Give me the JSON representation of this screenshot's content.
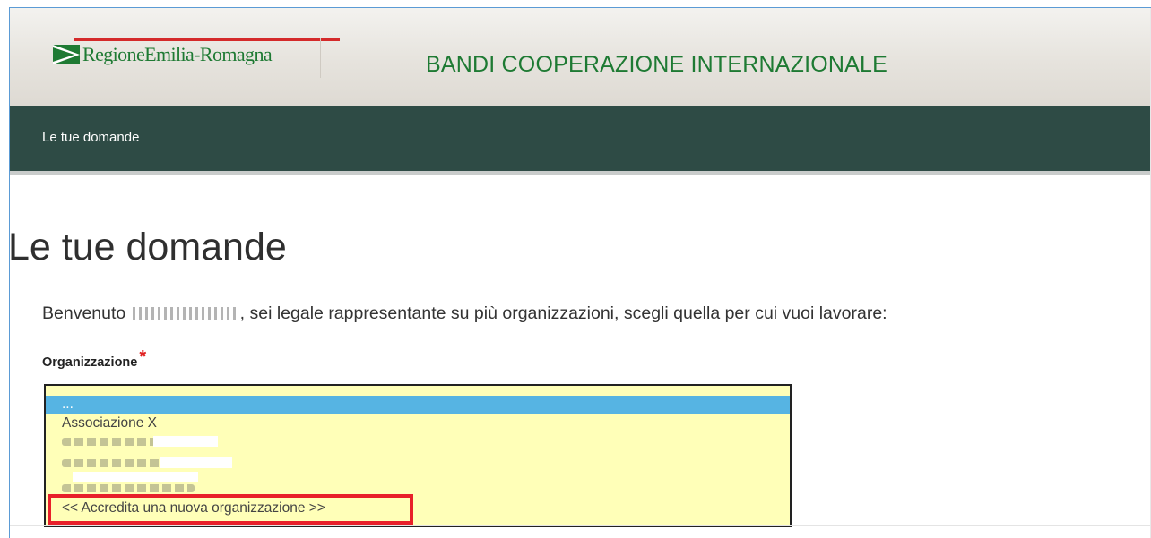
{
  "header": {
    "logo_text": "RegioneEmilia-Romagna",
    "site_title": "BANDI COOPERAZIONE INTERNAZIONALE"
  },
  "nav": {
    "link_label": "Le tue domande"
  },
  "main": {
    "page_title": "Le tue domande",
    "welcome_prefix": "Benvenuto",
    "welcome_suffix": ", sei legale rappresentante su più organizzazioni, scegli quella per cui vuoi lavorare:",
    "field_label": "Organizzazione",
    "required_mark": "*"
  },
  "listbox": {
    "options": [
      "...",
      "Associazione X",
      "",
      "",
      "",
      "<< Accredita una nuova organizzazione >>"
    ],
    "selected": "..."
  },
  "colors": {
    "brand_green": "#1e7a33",
    "nav_bg": "#2e4b45",
    "listbox_bg": "#ffffb8",
    "selected_bg": "#56b4e3",
    "highlight_red": "#e8202a"
  }
}
